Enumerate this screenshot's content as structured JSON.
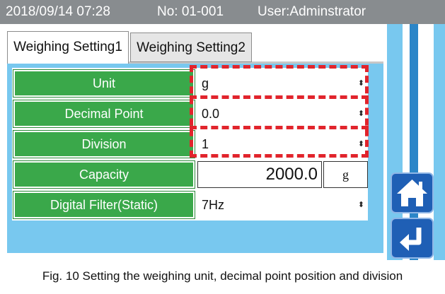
{
  "status_bar": {
    "datetime": "2018/09/14 07:28",
    "number": "No: 01-001",
    "user": "User:Adminstrator"
  },
  "tabs": [
    {
      "label": "Weighing Setting1",
      "active": true
    },
    {
      "label": "Weighing Setting2",
      "active": false
    }
  ],
  "settings": [
    {
      "label": "Unit",
      "value": "g"
    },
    {
      "label": "Decimal Point",
      "value": "0.0"
    },
    {
      "label": "Division",
      "value": "1"
    },
    {
      "label": "Capacity",
      "value": "2000.0",
      "unit": "g"
    },
    {
      "label": "Digital Filter(Static)",
      "value": "7Hz"
    }
  ],
  "select_arrow": "⬍",
  "buttons": {
    "home_icon": "home-icon",
    "back_icon": "return-icon"
  },
  "caption": "Fig. 10    Setting the weighing unit, decimal point position and division",
  "colors": {
    "label_green": "#3aa84a",
    "panel_blue": "#78c8ef",
    "status_gray": "#888c8f",
    "button_blue": "#1f5fb5",
    "highlight_red": "#e1242c"
  }
}
